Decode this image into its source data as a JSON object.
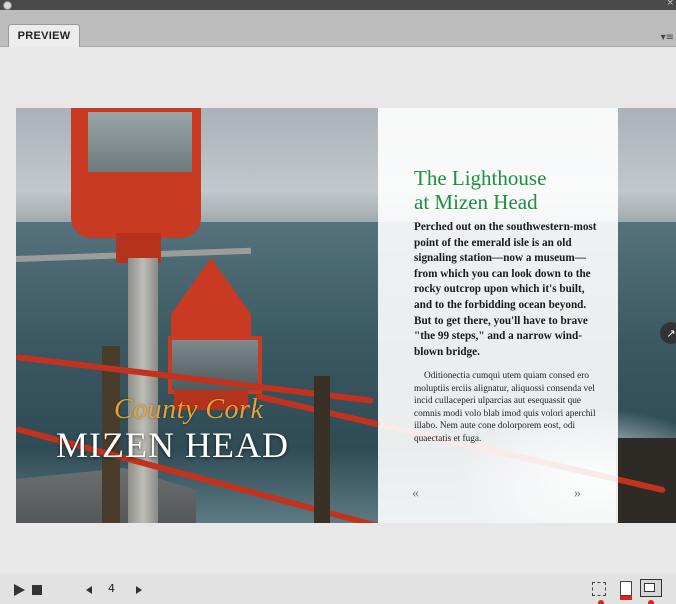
{
  "panel": {
    "tab_label": "PREVIEW",
    "menu_icon": "panel-menu-icon"
  },
  "article": {
    "script_title": "County Cork",
    "main_title": "MIZEN HEAD",
    "headline_line1": "The Lighthouse",
    "headline_line2": "at Mizen Head",
    "lead": "Perched out on the southwestern-most point of the emerald isle is an old signaling station—now a museum—from which you can look down to the rocky outcrop upon which it's built, and to the forbidding ocean beyond. But to get there, you'll have to brave \"the 99 steps,\" and a narrow wind-blown bridge.",
    "body": "Oditionectia cumqui utem quiam consed ero moluptiis erciis alignatur, aliquossi consenda vel incid cullaceperi ulparcias aut esequassit que comnis modi volo blab imod quis volori aperchil illabo. Nem aute cone dolorporem eost, odi quaectatis et fuga.",
    "prev_label": "«",
    "next_label": "»"
  },
  "controls": {
    "page_number": "4"
  },
  "colors": {
    "headline": "#1d8f3f",
    "script_title": "#e7a233",
    "accent_red": "#e0211e"
  }
}
